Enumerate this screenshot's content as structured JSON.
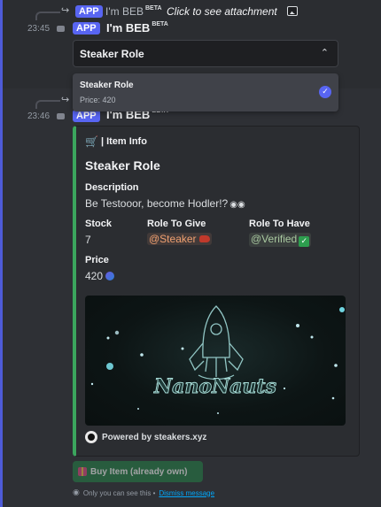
{
  "message_top": {
    "reply": {
      "tag": "APP",
      "author": "I'm BEB",
      "author_badge": "BETA",
      "text": "Click to see attachment",
      "attachment_icon": "image-icon"
    },
    "timestamp": "23:45",
    "tag": "APP",
    "author": "I'm BEB",
    "author_badge": "BETA",
    "select": {
      "value": "Steaker Role",
      "chevron": "chevron-up-icon"
    }
  },
  "dropdown": {
    "options": [
      {
        "label": "Steaker Role",
        "description": "Price: 420",
        "selected": true
      }
    ]
  },
  "message_bottom": {
    "timestamp": "23:46",
    "tag": "APP",
    "author": "I'm BEB",
    "author_badge": "BETA",
    "embed": {
      "accent_color": "#3ba55d",
      "author": "| Item Info",
      "title": "Steaker Role",
      "fields": {
        "description": {
          "name": "Description",
          "value": "Be Testooor, become Hodler!?"
        },
        "stock": {
          "name": "Stock",
          "value": "7"
        },
        "role_to_give": {
          "name": "Role To Give",
          "value": "@Steaker",
          "color": "#f0a070"
        },
        "role_to_have": {
          "name": "Role To Have",
          "value": "@Verified",
          "color": "#a9c9a0"
        },
        "price": {
          "name": "Price",
          "value": "420"
        }
      },
      "image_text": "NanoNauts",
      "footer": "Powered by steakers.xyz"
    },
    "button": {
      "label": "Buy Item (already own)",
      "color": "#248046"
    },
    "ephemeral": {
      "text": "Only you can see this •",
      "link": "Dismiss message"
    }
  }
}
